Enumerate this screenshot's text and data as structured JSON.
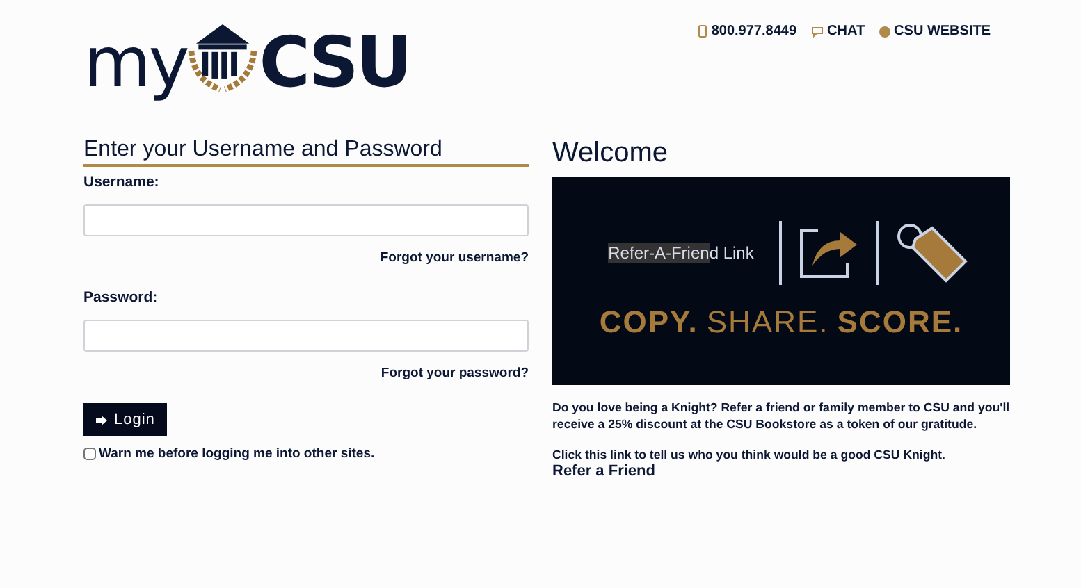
{
  "logo": {
    "left": "my",
    "right": "CSU"
  },
  "top_links": [
    {
      "kind": "phone",
      "label": "800.977.8449"
    },
    {
      "kind": "chat",
      "label": "CHAT"
    },
    {
      "kind": "web",
      "label": "CSU WEBSITE"
    }
  ],
  "login": {
    "heading": "Enter your Username and Password",
    "username_label": "Username:",
    "forgot_username": "Forgot your username?",
    "password_label": "Password:",
    "forgot_password": "Forgot your password?",
    "button": "Login",
    "warn": {
      "label": "Warn me before logging me into other sites.",
      "checked": false
    }
  },
  "welcome": {
    "heading": "Welcome",
    "banner": {
      "link_text_selected": "Refer-A-Frien",
      "link_text_rest": "d Link",
      "words": [
        "COPY.",
        "SHARE.",
        "SCORE."
      ]
    },
    "paragraph": "Do you love being a Knight? Refer a friend or family member to CSU and you'll receive a 25% discount at the CSU Bookstore as a token of our gratitude.",
    "cta": "Click this link to tell us who you think would be a good CSU Knight.",
    "cta_link": "Refer a Friend"
  }
}
